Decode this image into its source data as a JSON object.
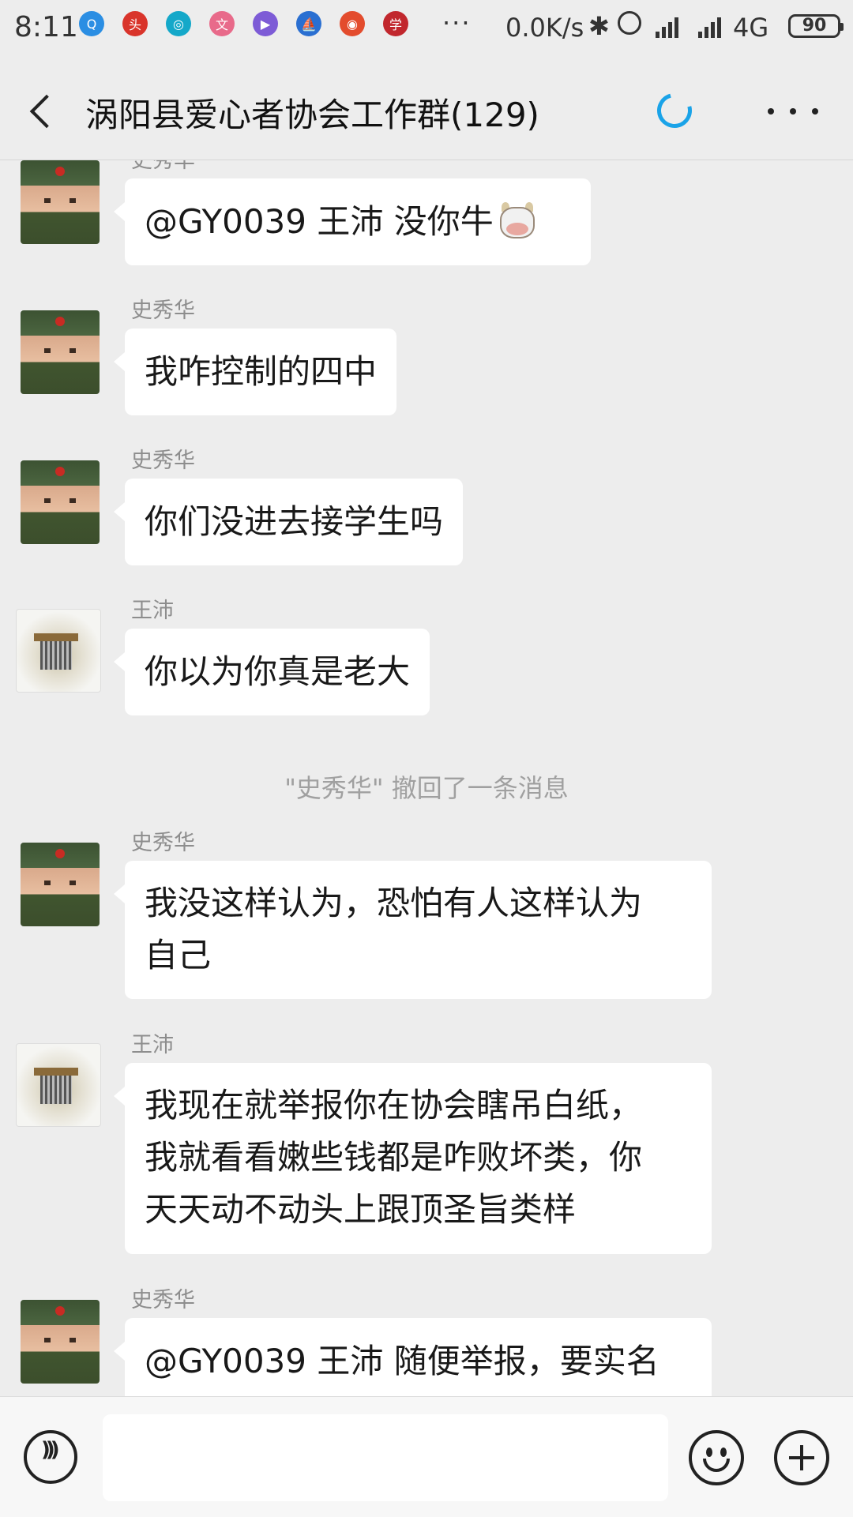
{
  "status_bar": {
    "time": "8:11",
    "dots": "···",
    "net_speed": "0.0K/s",
    "network_type": "4G",
    "battery": "90",
    "notification_icons": [
      {
        "name": "qq-icon",
        "color": "#2b8ee3",
        "glyph": "Q"
      },
      {
        "name": "app-red-icon",
        "color": "#d9342b",
        "glyph": "头"
      },
      {
        "name": "app-cyan-icon",
        "color": "#14a8c9",
        "glyph": "◎"
      },
      {
        "name": "app-pink-icon",
        "color": "#e86a8a",
        "glyph": "文"
      },
      {
        "name": "app-purple-icon",
        "color": "#7d5bd6",
        "glyph": "▶"
      },
      {
        "name": "app-blue-icon",
        "color": "#2a6fd1",
        "glyph": "⛵"
      },
      {
        "name": "app-multi-icon",
        "color": "#e34c2d",
        "glyph": "◉"
      },
      {
        "name": "app-seal-icon",
        "color": "#c1272d",
        "glyph": "学"
      }
    ]
  },
  "title_bar": {
    "title": "涡阳县爱心者协会工作群(129)"
  },
  "messages": [
    {
      "sender": "史秀华",
      "avatar": "soldier",
      "text": "@GY0039 王沛  没你牛",
      "emoji": "cow-face"
    },
    {
      "sender": "史秀华",
      "avatar": "soldier",
      "text": "我咋控制的四中"
    },
    {
      "sender": "史秀华",
      "avatar": "soldier",
      "text": "你们没进去接学生吗"
    },
    {
      "sender": "王沛",
      "avatar": "gate",
      "text": "你以为你真是老大"
    },
    {
      "system": "\"史秀华\" 撤回了一条消息"
    },
    {
      "sender": "史秀华",
      "avatar": "soldier",
      "lines": [
        "我没这样认为，恐怕有人这样认为",
        "自己"
      ]
    },
    {
      "sender": "王沛",
      "avatar": "gate",
      "lines": [
        "我现在就举报你在协会瞎吊白纸，",
        "我就看看嫩些钱都是咋败坏类，你",
        "天天动不动头上跟顶圣旨类样"
      ]
    },
    {
      "sender": "史秀华",
      "avatar": "soldier",
      "text": "@GY0039 王沛  随便举报，要实名"
    }
  ],
  "input_bar": {
    "placeholder": ""
  }
}
